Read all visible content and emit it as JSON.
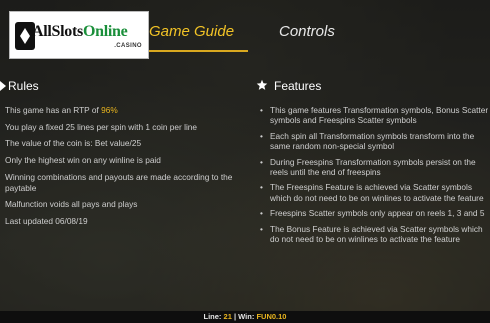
{
  "logo": {
    "text_main": "AllSlots",
    "text_accent": "Online",
    "subtext": ".CASINO",
    "icon": "playing-card-icon"
  },
  "tabs": [
    {
      "label": "Game Guide",
      "active": true
    },
    {
      "label": "Controls",
      "active": false
    }
  ],
  "rules": {
    "title": "Rules",
    "icon": "chevron-right-icon",
    "items": [
      {
        "pre": "This game has an RTP of ",
        "highlight": "96%"
      },
      {
        "pre": "You play a fixed 25 lines per spin with 1 coin per line"
      },
      {
        "pre": "The value of the coin is: Bet value/25"
      },
      {
        "pre": "Only the highest win on any winline is paid"
      },
      {
        "pre": "Winning combinations and payouts are made according to the paytable"
      },
      {
        "pre": "Malfunction voids all pays and plays"
      },
      {
        "pre": "Last updated 06/08/19"
      }
    ]
  },
  "features": {
    "title": "Features",
    "icon": "star-icon",
    "items": [
      "This game features Transformation symbols, Bonus Scatter symbols and Freespins Scatter symbols",
      "Each spin all Transformation symbols transform into the same random non-special symbol",
      "During Freespins Transformation symbols persist on the reels until the end of freespins",
      "The Freespins Feature is achieved via Scatter symbols which do not need to be on winlines to activate the feature",
      "Freespins Scatter symbols only appear on reels 1, 3 and 5",
      "The Bonus Feature is achieved via Scatter symbols which do not need to be on winlines to activate the feature"
    ]
  },
  "statusbar": {
    "line_label": "Line:",
    "line_value": "21",
    "separator": "|",
    "win_label": "Win:",
    "win_value": "FUN0.10"
  },
  "colors": {
    "accent": "#f2c326",
    "highlight": "#e9b51f"
  }
}
